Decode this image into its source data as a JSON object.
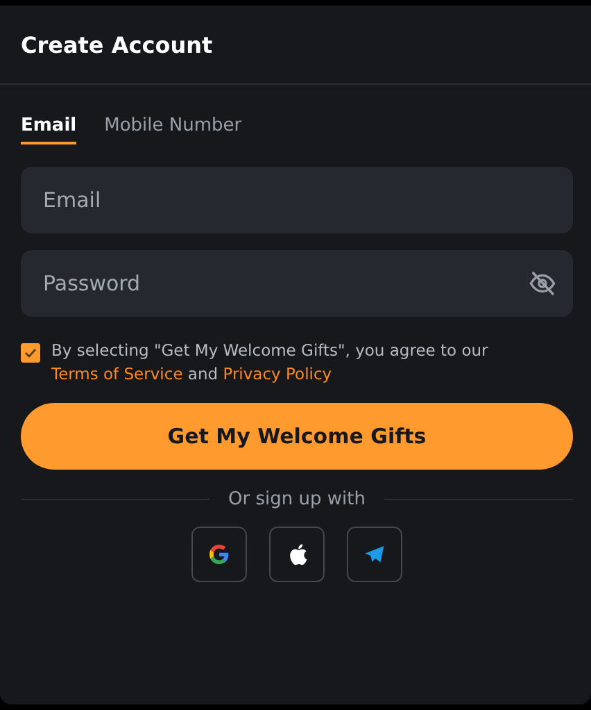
{
  "title": "Create Account",
  "tabs": [
    {
      "label": "Email",
      "selected": true
    },
    {
      "label": "Mobile Number",
      "selected": false
    }
  ],
  "fields": [
    {
      "kind": "text",
      "placeholder": "Email"
    },
    {
      "kind": "password",
      "placeholder": "Password"
    }
  ],
  "agreement": {
    "checked": true,
    "parts": [
      {
        "kind": "text",
        "text": "By selecting \"Get My Welcome Gifts\", you agree to our "
      },
      {
        "kind": "link",
        "text": "Terms of Service"
      },
      {
        "kind": "text",
        "text": " and "
      },
      {
        "kind": "link",
        "text": "Privacy Policy"
      }
    ]
  },
  "submit": "Get My Welcome Gifts",
  "divider": "Or sign up with",
  "social": [
    {
      "kind": "google"
    },
    {
      "kind": "apple"
    },
    {
      "kind": "telegram"
    }
  ]
}
